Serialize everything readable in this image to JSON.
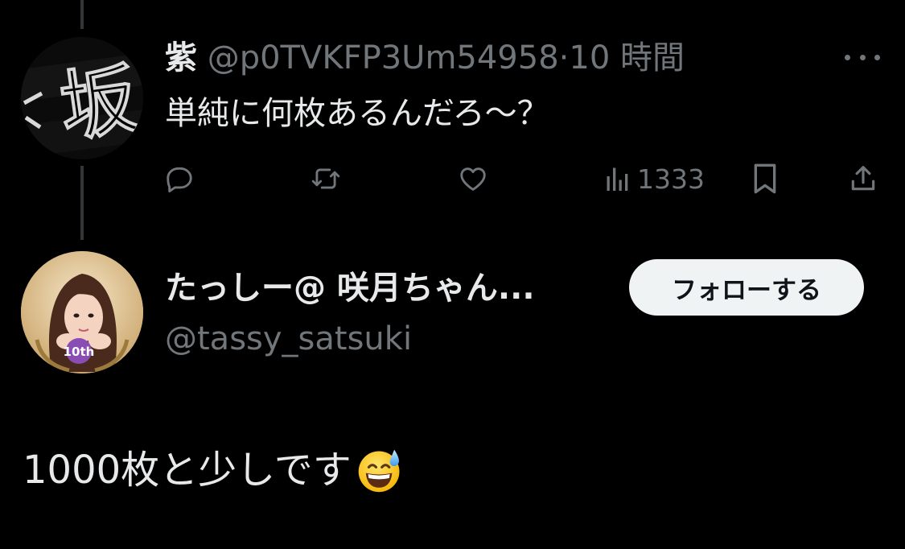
{
  "tweet1": {
    "avatar_text": "坂",
    "name": "紫",
    "handle": "@p0TVKFP3Um54958",
    "separator": "·",
    "time": "10 時間",
    "body": "単純に何枚あるんだろ〜？",
    "actions": {
      "reply_icon": "reply-icon",
      "retweet_icon": "retweet-icon",
      "like_icon": "heart-icon",
      "views_icon": "views-chart-icon",
      "views": "1333",
      "bookmark_icon": "bookmark-icon",
      "share_icon": "share-icon"
    }
  },
  "tweet2": {
    "avatar_badge": "10th",
    "name": "たっしー@ 咲月ちゃん...",
    "handle": "@tassy_satsuki",
    "follow_label": "フォローする",
    "body": "1000枚と少しです",
    "emoji": "grinning-face-with-sweat-emoji"
  },
  "colors": {
    "background": "#000000",
    "primary_text": "#e7e9ea",
    "secondary_text": "#71767b",
    "button_bg": "#eff3f4",
    "button_text": "#0f1419",
    "thread_line": "#333639"
  }
}
